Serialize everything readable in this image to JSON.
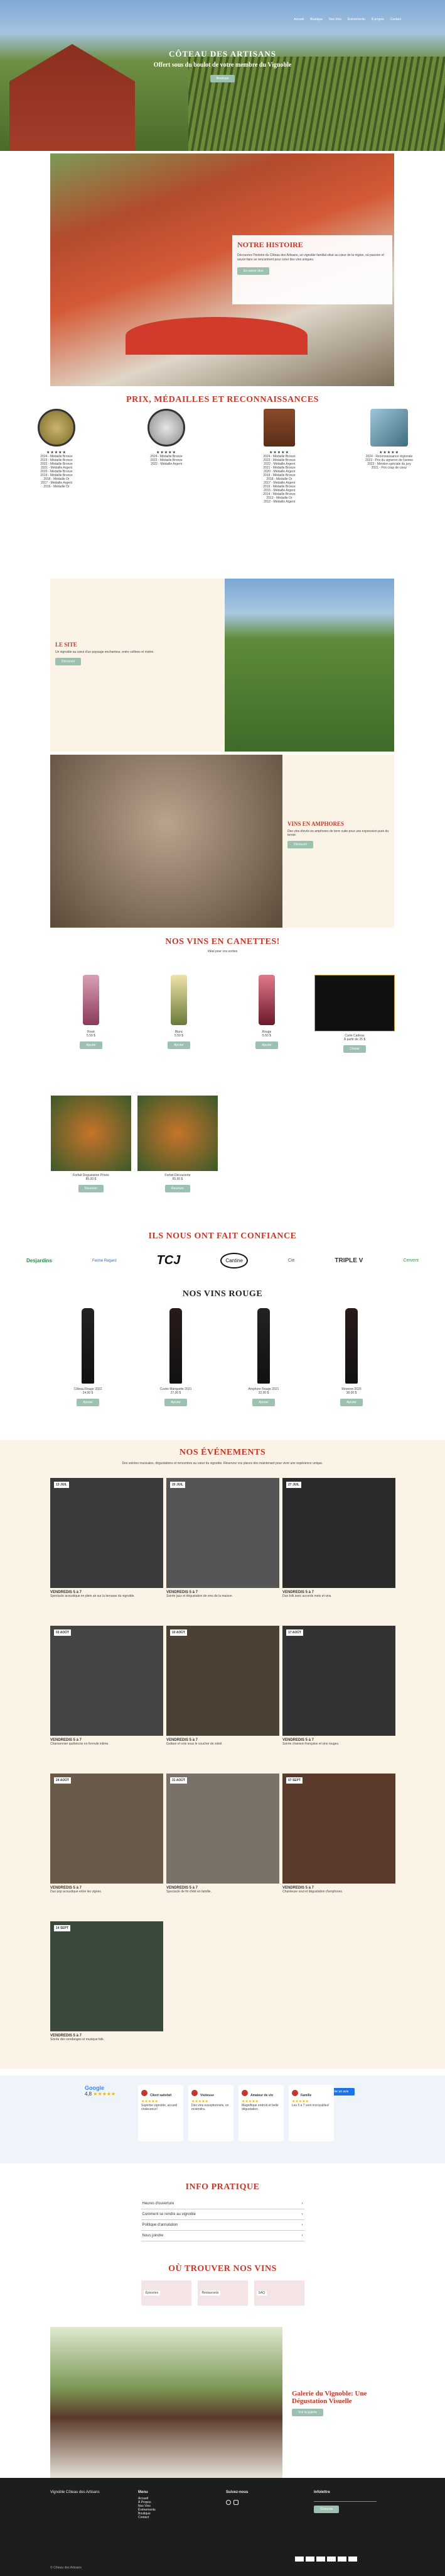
{
  "nav": {
    "items": [
      "Accueil",
      "Boutique",
      "Nos Vins",
      "Événements",
      "À propos",
      "Contact"
    ]
  },
  "hero": {
    "title": "CÔTEAU DES ARTISANS",
    "subtitle": "Offert sous du boulot de votre membre du Vignoble",
    "cta": "Boutique"
  },
  "story": {
    "title": "NOTRE HISTOIRE",
    "text": "Découvrez l'histoire du Côteau des Artisans, un vignoble familial situé au cœur de la région, où passion et savoir-faire se rencontrent pour créer des vins uniques.",
    "cta": "En savoir plus"
  },
  "awards": {
    "title": "PRIX, MÉDAILLES ET RECONNAISSANCES",
    "items": [
      {
        "stars": "★★★★★",
        "lines": [
          "2024 - Médaille Bronze",
          "2023 - Médaille Bronze",
          "2022 - Médaille Bronze",
          "2021 - Médaille Argent",
          "2020 - Médaille Bronze",
          "2019 - Médaille Bronze",
          "2018 - Médaille Or",
          "2017 - Médaille Argent",
          "2016 - Médaille Or"
        ]
      },
      {
        "stars": "★★★★★",
        "lines": [
          "2024 - Médaille Bronze",
          "2023 - Médaille Bronze",
          "2022 - Médaille Argent"
        ]
      },
      {
        "stars": "★★★★★",
        "lines": [
          "2024 - Médaille Bronze",
          "2023 - Médaille Bronze",
          "2022 - Médaille Argent",
          "2021 - Médaille Bronze",
          "2020 - Médaille Argent",
          "2019 - Médaille Bronze",
          "2018 - Médaille Or",
          "2017 - Médaille Argent",
          "2016 - Médaille Bronze",
          "2015 - Médaille Argent",
          "2014 - Médaille Bronze",
          "2013 - Médaille Or",
          "2012 - Médaille Argent"
        ]
      },
      {
        "stars": "★★★★★",
        "lines": [
          "2024 - Reconnaissance régionale",
          "2023 - Prix du vigneron de l'année",
          "2022 - Mention spéciale du jury",
          "2021 - Prix coup de cœur"
        ]
      }
    ]
  },
  "site": {
    "title": "LE SITE",
    "text": "Un vignoble au cœur d'un paysage enchanteur, entre collines et rivière.",
    "cta": "Découvrir"
  },
  "amphora": {
    "title": "VINS EN AMPHORES",
    "text": "Des vins élevés en amphores de terre cuite pour une expression pure du terroir.",
    "cta": "Découvrir"
  },
  "cans": {
    "title": "NOS VINS EN CANETTES!",
    "subtitle": "Idéal pour vos sorties",
    "products": [
      {
        "name": "Rosé",
        "price": "5,50 $",
        "cta": "Ajouter"
      },
      {
        "name": "Blanc",
        "price": "5,50 $",
        "cta": "Ajouter"
      },
      {
        "name": "Rouge",
        "price": "5,50 $",
        "cta": "Ajouter"
      },
      {
        "name": "Carte Cadeau",
        "price": "À partir de 25 $",
        "cta": "Choisir"
      }
    ],
    "extras": [
      {
        "name": "Forfait Degustation Privée",
        "price": "85,00 $",
        "cta": "Réserver"
      },
      {
        "name": "Forfait Découverte",
        "price": "65,00 $",
        "cta": "Réserver"
      }
    ]
  },
  "trust": {
    "title": "ILS NOUS ONT FAIT CONFIANCE",
    "logos": [
      "Desjardins",
      "Ferme Regard",
      "TCJ",
      "Cantine",
      "Cie",
      "TRIPLE V",
      "Cervent"
    ]
  },
  "reds": {
    "title": "NOS VINS ROUGE",
    "products": [
      {
        "name": "Côteau Rouge 2022",
        "price": "24,00 $",
        "cta": "Ajouter"
      },
      {
        "name": "Cuvée Marquette 2021",
        "price": "27,00 $",
        "cta": "Ajouter"
      },
      {
        "name": "Amphore Rouge 2021",
        "price": "32,00 $",
        "cta": "Ajouter"
      },
      {
        "name": "Réserve 2020",
        "price": "38,00 $",
        "cta": "Ajouter"
      }
    ]
  },
  "events": {
    "title": "NOS ÉVÉNEMENTS",
    "intro": "Des soirées musicales, dégustations et rencontres au cœur du vignoble. Réservez vos places dès maintenant pour vivre une expérience unique.",
    "items": [
      {
        "date": "13 JUIL",
        "label": "VENDREDIS 5 à 7",
        "text": "Spectacle acoustique en plein air sur la terrasse du vignoble."
      },
      {
        "date": "20 JUIL",
        "label": "VENDREDIS 5 à 7",
        "text": "Soirée jazz et dégustation de vins de la maison."
      },
      {
        "date": "27 JUIL",
        "label": "VENDREDIS 5 à 7",
        "text": "Duo folk avec accords mets et vins."
      },
      {
        "date": "03 AOÛT",
        "label": "VENDREDIS 5 à 7",
        "text": "Chansonnier québécois en formule intime."
      },
      {
        "date": "10 AOÛT",
        "label": "VENDREDIS 5 à 7",
        "text": "Guitare et voix sous le coucher de soleil."
      },
      {
        "date": "17 AOÛT",
        "label": "VENDREDIS 5 à 7",
        "text": "Soirée chanson française et vins rouges."
      },
      {
        "date": "24 AOÛT",
        "label": "VENDREDIS 5 à 7",
        "text": "Duo pop acoustique entre les vignes."
      },
      {
        "date": "31 AOÛT",
        "label": "VENDREDIS 5 à 7",
        "text": "Spectacle de fin d'été en famille."
      },
      {
        "date": "07 SEPT",
        "label": "VENDREDIS 5 à 7",
        "text": "Chanteuse soul et dégustation d'amphores."
      },
      {
        "date": "14 SEPT",
        "label": "VENDREDIS 5 à 7",
        "text": "Soirée des vendanges et musique folk."
      }
    ]
  },
  "reviews": {
    "brand": "Google",
    "rating": "4,8",
    "cta": "Écrire un avis",
    "items": [
      {
        "name": "Client satisfait",
        "text": "Superbe vignoble, accueil chaleureux!"
      },
      {
        "name": "Visiteuse",
        "text": "Des vins exceptionnels, on reviendra."
      },
      {
        "name": "Amateur de vin",
        "text": "Magnifique endroit et belle dégustation."
      },
      {
        "name": "Famille",
        "text": "Les 5 à 7 sont incroyables!"
      }
    ]
  },
  "info": {
    "title": "INFO PRATIQUE",
    "rows": [
      "Heures d'ouverture",
      "Comment se rendre au vignoble",
      "Politique d'annulation",
      "Nous joindre"
    ]
  },
  "where": {
    "title": "OÙ TROUVER NOS VINS",
    "maps": [
      "Épiceries",
      "Restaurants",
      "SAQ"
    ]
  },
  "gallery": {
    "title": "Galerie du Vignoble: Une Dégustation Visuelle",
    "cta": "Voir la galerie"
  },
  "footer": {
    "brand": "Vignoble Côteau des Artisans",
    "menu_title": "Menu",
    "menu": [
      "Accueil",
      "À Propos",
      "Nos Vins",
      "Événements",
      "Boutique",
      "Contact"
    ],
    "social_title": "Suivez-nous",
    "news_title": "Infolettre",
    "news_cta": "S'inscrire",
    "copy": "© Côteau des Artisans"
  }
}
